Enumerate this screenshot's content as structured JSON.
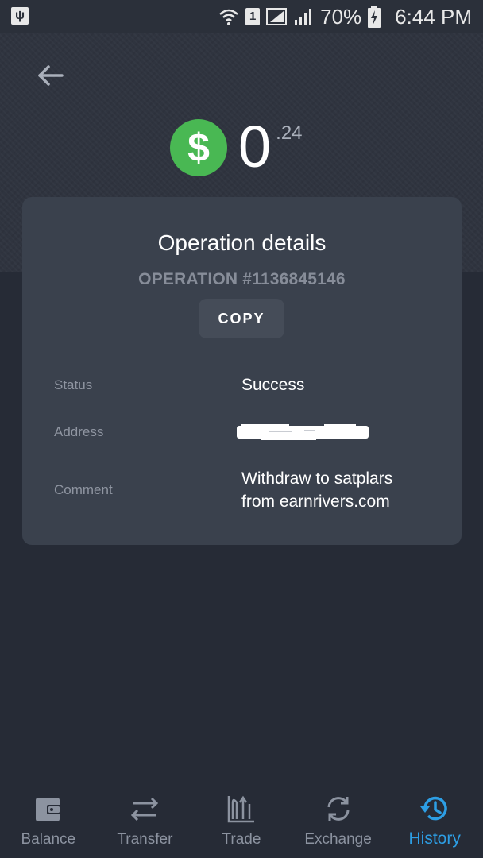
{
  "status_bar": {
    "battery": "70%",
    "time": "6:44 PM",
    "sim_slot": "1"
  },
  "header": {
    "back_icon": "arrow-left-icon"
  },
  "balance": {
    "currency_icon": "$",
    "integer": "0",
    "fraction": ".24"
  },
  "card": {
    "title": "Operation details",
    "operation_number": "OPERATION #1136845146",
    "copy_label": "COPY",
    "rows": [
      {
        "label": "Status",
        "value": "Success"
      },
      {
        "label": "Address",
        "value": ""
      },
      {
        "label": "Comment",
        "value": "Withdraw to satplars\nfrom earnrivers.com"
      }
    ]
  },
  "nav": {
    "items": [
      {
        "label": "Balance",
        "icon": "wallet-icon"
      },
      {
        "label": "Transfer",
        "icon": "transfer-arrows-icon"
      },
      {
        "label": "Trade",
        "icon": "trade-chart-icon"
      },
      {
        "label": "Exchange",
        "icon": "exchange-cycle-icon"
      },
      {
        "label": "History",
        "icon": "history-clock-icon"
      }
    ],
    "active_index": 4
  },
  "colors": {
    "background": "#262b36",
    "card": "#3a414d",
    "accent_green": "#49b853",
    "accent_blue": "#2d9ee4",
    "muted_text": "#8f95a1"
  }
}
